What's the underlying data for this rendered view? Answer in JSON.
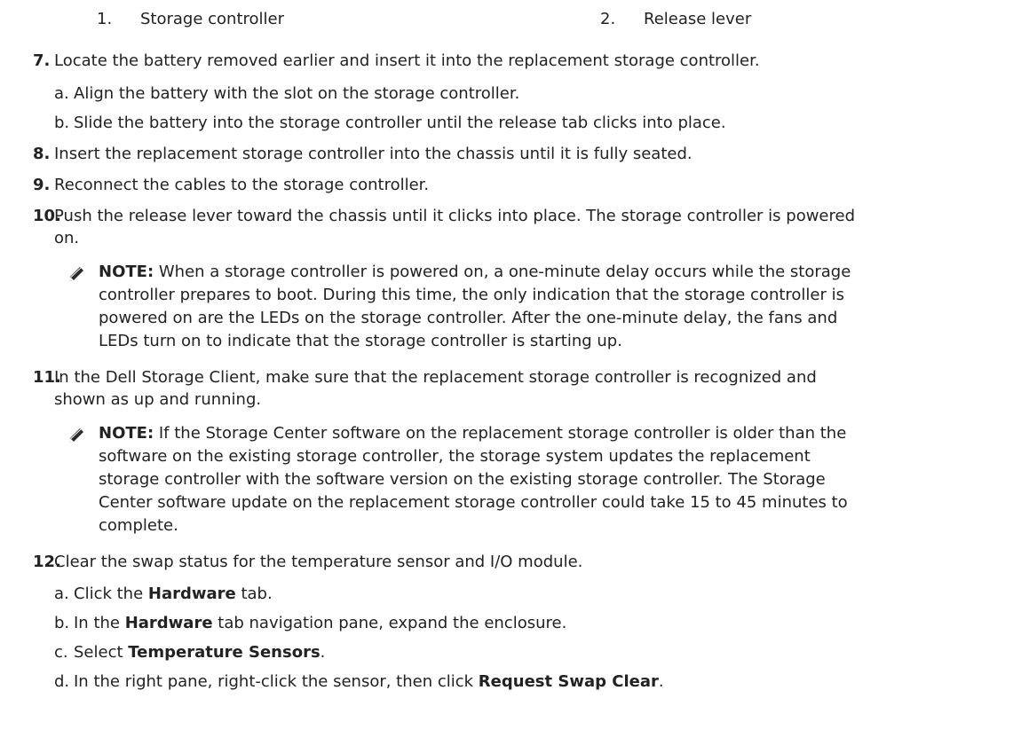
{
  "legend": {
    "item1": {
      "num": "1.",
      "label": "Storage controller"
    },
    "item2": {
      "num": "2.",
      "label": "Release lever"
    }
  },
  "step7": {
    "num": "7.",
    "text": "Locate the battery removed earlier and insert it into the replacement storage controller.",
    "sub_a": {
      "letter": "a.",
      "text": "Align the battery with the slot on the storage controller."
    },
    "sub_b": {
      "letter": "b.",
      "text": "Slide the battery into the storage controller until the release tab clicks into place."
    }
  },
  "step8": {
    "num": "8.",
    "text": "Insert the replacement storage controller into the chassis until it is fully seated."
  },
  "step9": {
    "num": "9.",
    "text": "Reconnect the cables to the storage controller."
  },
  "step10": {
    "num": "10.",
    "line1": "Push the release lever toward the chassis until it clicks into place. The storage controller is powered",
    "line2": "on."
  },
  "note1": {
    "label": "NOTE:",
    "line1": " When a storage controller is powered on, a one-minute delay occurs while the storage",
    "line2": "controller prepares to boot. During this time, the only indication that the storage controller is",
    "line3": "powered on are the LEDs on the storage controller. After the one-minute delay, the fans and",
    "line4": "LEDs turn on to indicate that the storage controller is starting up."
  },
  "step11": {
    "num": "11.",
    "line1": "In the Dell Storage Client, make sure that the replacement storage controller is recognized and",
    "line2": "shown as up and running."
  },
  "note2": {
    "label": "NOTE:",
    "line1": " If the Storage Center software on the replacement storage controller is older than the",
    "line2": "software on the existing storage controller, the storage system updates the replacement",
    "line3": "storage controller with the software version on the existing storage controller. The Storage",
    "line4": "Center software update on the replacement storage controller could take 15 to 45 minutes to",
    "line5": "complete."
  },
  "step12": {
    "num": "12.",
    "text": "Clear the swap status for the temperature sensor and I/O module.",
    "sub_a": {
      "letter": "a.",
      "pre": "Click the ",
      "bold": "Hardware",
      "post": " tab."
    },
    "sub_b": {
      "letter": "b.",
      "pre": "In the ",
      "bold": "Hardware",
      "post": " tab navigation pane, expand the enclosure."
    },
    "sub_c": {
      "letter": "c.",
      "pre": "Select ",
      "bold": "Temperature Sensors",
      "post": "."
    },
    "sub_d": {
      "letter": "d.",
      "pre": "In the right pane, right-click the sensor, then click ",
      "bold": "Request Swap Clear",
      "post": "."
    }
  },
  "icons": {
    "note": "note-pencil-icon"
  }
}
